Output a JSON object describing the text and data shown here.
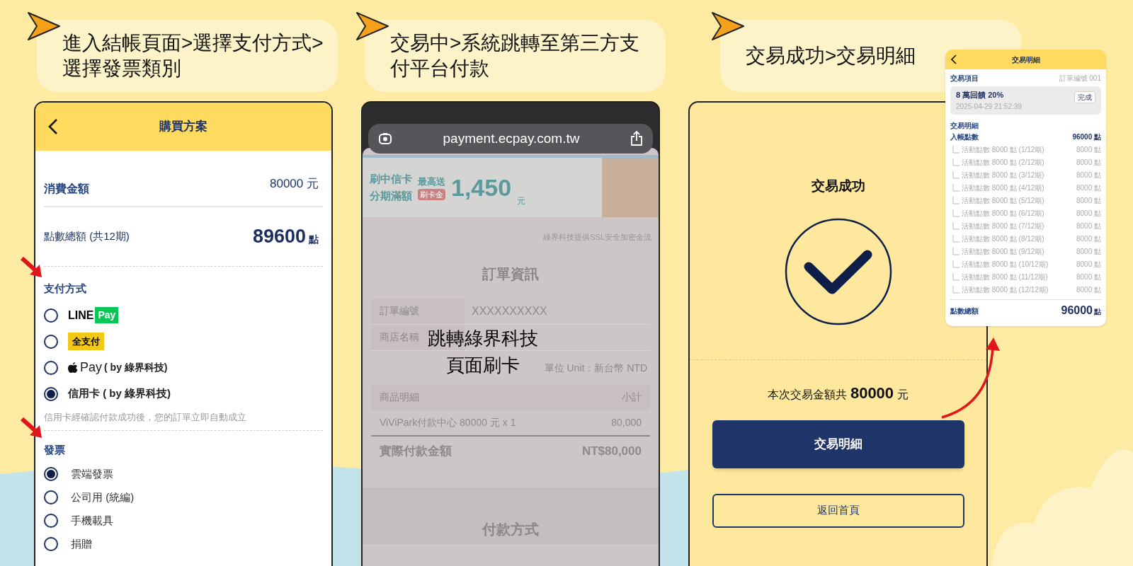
{
  "steps": [
    {
      "text": "進入結帳頁面>選擇支付方式>選擇發票類別"
    },
    {
      "text": "交易中>系統跳轉至第三方支付平台付款"
    },
    {
      "text": "交易成功>交易明細"
    }
  ],
  "checkout": {
    "title": "購買方案",
    "amount_label": "消費金額",
    "amount_value": "80000 元",
    "points_label": "點數總額 (共12期)",
    "points_value": "89600",
    "points_unit": "點",
    "payment_title": "支付方式",
    "payment_options": [
      {
        "kind": "linepay",
        "parts": [
          "LINE",
          "Pay"
        ],
        "selected": false
      },
      {
        "kind": "pxpay",
        "parts": [
          "全支付"
        ],
        "selected": false
      },
      {
        "kind": "applepay",
        "parts": [
          "Pay",
          "( by 綠界科技)"
        ],
        "selected": false
      },
      {
        "kind": "text",
        "parts": [
          "信用卡 ( by 綠界科技)"
        ],
        "selected": true
      }
    ],
    "payment_note": "信用卡經確認付款成功後，您的訂單立即自動成立",
    "invoice_title": "發票",
    "invoice_options": [
      {
        "label": "雲端發票",
        "selected": true
      },
      {
        "label": "公司用 (統編)",
        "selected": false
      },
      {
        "label": "手機載具",
        "selected": false
      },
      {
        "label": "捐贈",
        "selected": false
      }
    ]
  },
  "payment": {
    "url": "payment.ecpay.com.tw",
    "banner_texts": [
      "刷中信卡",
      "分期滿額",
      "最高送",
      "刷卡金",
      "1,450",
      "元"
    ],
    "ssl_note": "綠界科技提供SSL安全加密金流",
    "section_title": "訂單資訊",
    "info_rows": [
      {
        "label": "訂單編號",
        "value": "XXXXXXXXXX"
      },
      {
        "label": "商店名稱",
        "value": ""
      }
    ],
    "unit": "單位 Unit：新台幣 NTD",
    "item_header": [
      "商品明細",
      "小計"
    ],
    "item_row": [
      "ViViPark付款中心 80000 元 x 1",
      "80,000"
    ],
    "total_row": [
      "實際付款金額",
      "NT$80,000"
    ],
    "next_section": "付款方式",
    "overlay_lines": [
      "跳轉綠界科技",
      "頁面刷卡"
    ]
  },
  "success": {
    "title": "交易成功",
    "amount_sentence": "本次交易金額共 **80000** 元",
    "buttons": [
      {
        "kind": "primary",
        "label": "交易明細"
      },
      {
        "kind": "outline",
        "label": "返回首頁"
      }
    ]
  },
  "detail": {
    "title": "交易明細",
    "item_label": "交易項目",
    "order_no": "訂單編號 001",
    "card_title": "8 萬回饋 20%",
    "card_date": "2025-04-29 21:52:39",
    "card_badge": "完成",
    "detail_label": "交易明細",
    "credited_label": "入帳點數",
    "credited_value": "96000 點",
    "rows": [
      {
        "label": "活動點數 8000 點 (1/12期)",
        "value": "8000 點"
      },
      {
        "label": "活動點數 8000 點 (2/12期)",
        "value": "8000 點"
      },
      {
        "label": "活動點數 8000 點 (3/12期)",
        "value": "8000 點"
      },
      {
        "label": "活動點數 8000 點 (4/12期)",
        "value": "8000 點"
      },
      {
        "label": "活動點數 8000 點 (5/12期)",
        "value": "8000 點"
      },
      {
        "label": "活動點數 8000 點 (6/12期)",
        "value": "8000 點"
      },
      {
        "label": "活動點數 8000 點 (7/12期)",
        "value": "8000 點"
      },
      {
        "label": "活動點數 8000 點 (8/12期)",
        "value": "8000 點"
      },
      {
        "label": "活動點數 8000 點 (9/12期)",
        "value": "8000 點"
      },
      {
        "label": "活動點數 8000 點 (10/12期)",
        "value": "8000 點"
      },
      {
        "label": "活動點數 8000 點 (11/12期)",
        "value": "8000 點"
      },
      {
        "label": "活動點數 8000 點 (12/12期)",
        "value": "8000 點"
      }
    ],
    "total_label": "點數總額",
    "total_value": "96000",
    "total_unit": "點"
  }
}
